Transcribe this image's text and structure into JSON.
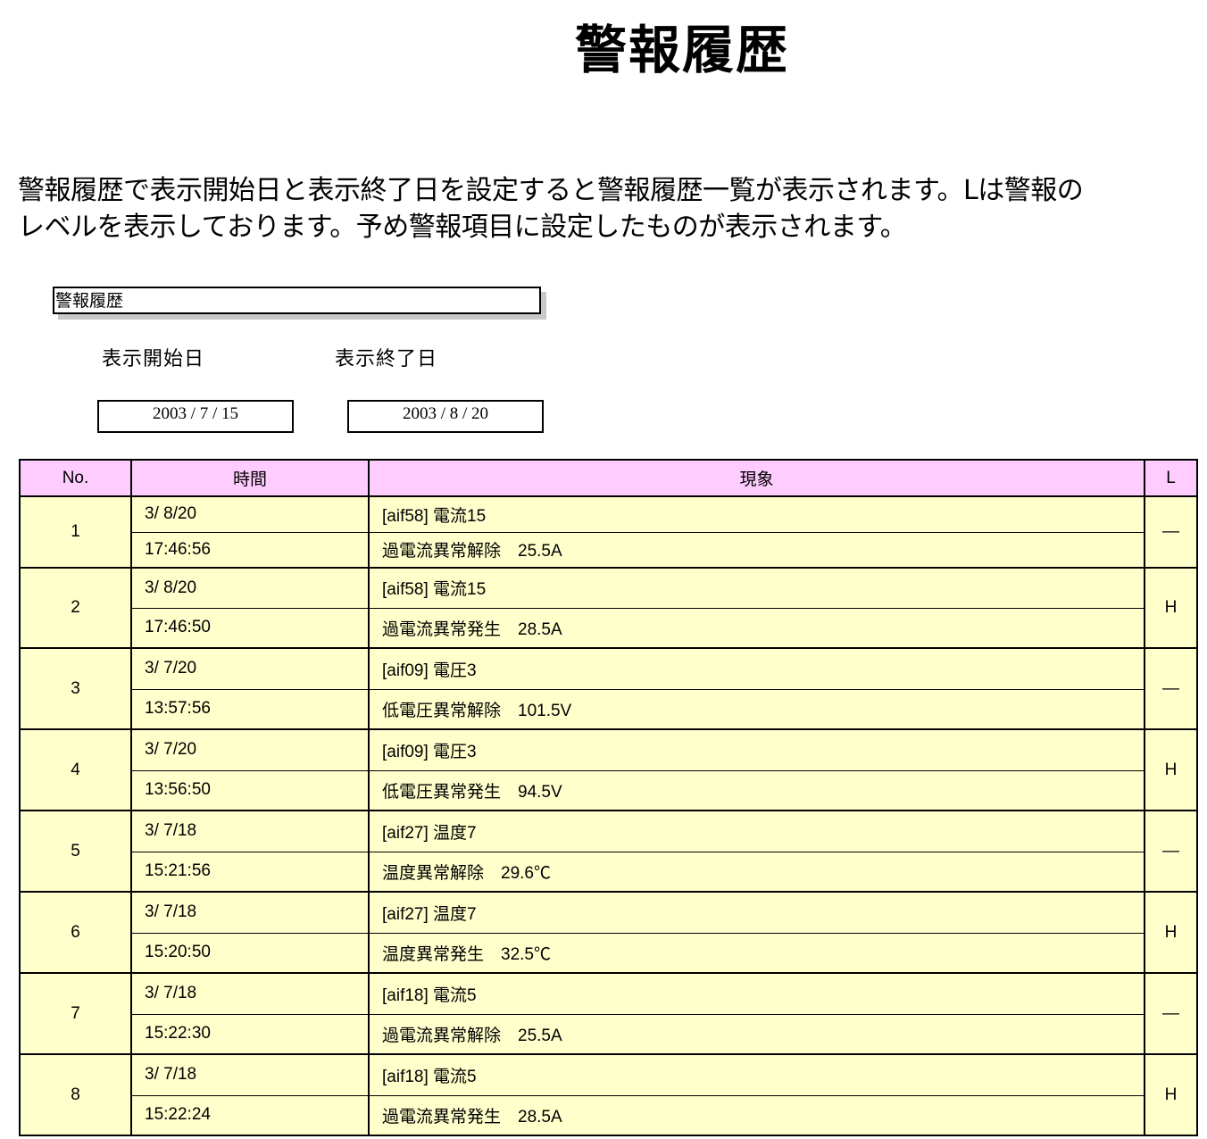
{
  "page": {
    "title": "警報履歴",
    "description_lines": [
      "警報履歴で表示開始日と表示終了日を設定すると警報履歴一覧が表示されます。Lは警報の",
      "レベルを表示しております。予め警報項目に設定したものが表示されます。"
    ]
  },
  "panel": {
    "title": "警報履歴",
    "start_label": "表示開始日",
    "end_label": "表示終了日",
    "start_date": "2003 / 7 / 15",
    "end_date": "2003 / 8 / 20"
  },
  "table": {
    "headers": {
      "no": "No.",
      "time": "時間",
      "event": "現象",
      "level": "L"
    },
    "rows": [
      {
        "no": "1",
        "date": "3/ 8/20",
        "time": "17:46:56",
        "point": "[aif58] 電流15",
        "event": "過電流異常解除　25.5A",
        "level": "―"
      },
      {
        "no": "2",
        "date": "3/ 8/20",
        "time": "17:46:50",
        "point": "[aif58] 電流15",
        "event": "過電流異常発生　28.5A",
        "level": "H"
      },
      {
        "no": "3",
        "date": "3/ 7/20",
        "time": "13:57:56",
        "point": "[aif09] 電圧3",
        "event": "低電圧異常解除　101.5V",
        "level": "―"
      },
      {
        "no": "4",
        "date": "3/ 7/20",
        "time": "13:56:50",
        "point": "[aif09] 電圧3",
        "event": "低電圧異常発生　94.5V",
        "level": "H"
      },
      {
        "no": "5",
        "date": "3/ 7/18",
        "time": "15:21:56",
        "point": "[aif27] 温度7",
        "event": "温度異常解除　29.6℃",
        "level": "―"
      },
      {
        "no": "6",
        "date": "3/ 7/18",
        "time": "15:20:50",
        "point": "[aif27] 温度7",
        "event": "温度異常発生　32.5℃",
        "level": "H"
      },
      {
        "no": "7",
        "date": "3/ 7/18",
        "time": "15:22:30",
        "point": "[aif18] 電流5",
        "event": "過電流異常解除　25.5A",
        "level": "―"
      },
      {
        "no": "8",
        "date": "3/ 7/18",
        "time": "15:22:24",
        "point": "[aif18] 電流5",
        "event": "過電流異常発生　28.5A",
        "level": "H"
      }
    ]
  },
  "colors": {
    "header_bg": "#ffccff",
    "row_bg": "#ffffcc"
  }
}
